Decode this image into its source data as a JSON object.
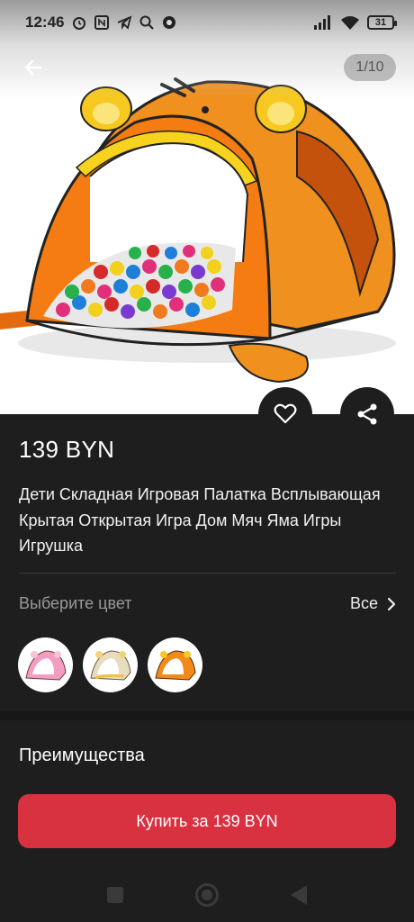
{
  "status_bar": {
    "time": "12:46",
    "battery": "31"
  },
  "gallery": {
    "counter": "1/10"
  },
  "product": {
    "price": "139 BYN",
    "title": "Дети Складная Игровая Палатка Всплывающая Крытая Открытая Игра Дом Мяч Яма Игры Игрушка"
  },
  "color_picker": {
    "label": "Выберите цвет",
    "all_label": "Все",
    "swatches": [
      "pink-tent",
      "beige-tent",
      "orange-tent"
    ]
  },
  "advantages": {
    "title": "Преимущества"
  },
  "buy_button": {
    "label": "Купить за 139 BYN"
  },
  "colors": {
    "accent": "#d8313f",
    "background": "#1e1e1e",
    "tent_orange": "#f28a1a"
  }
}
